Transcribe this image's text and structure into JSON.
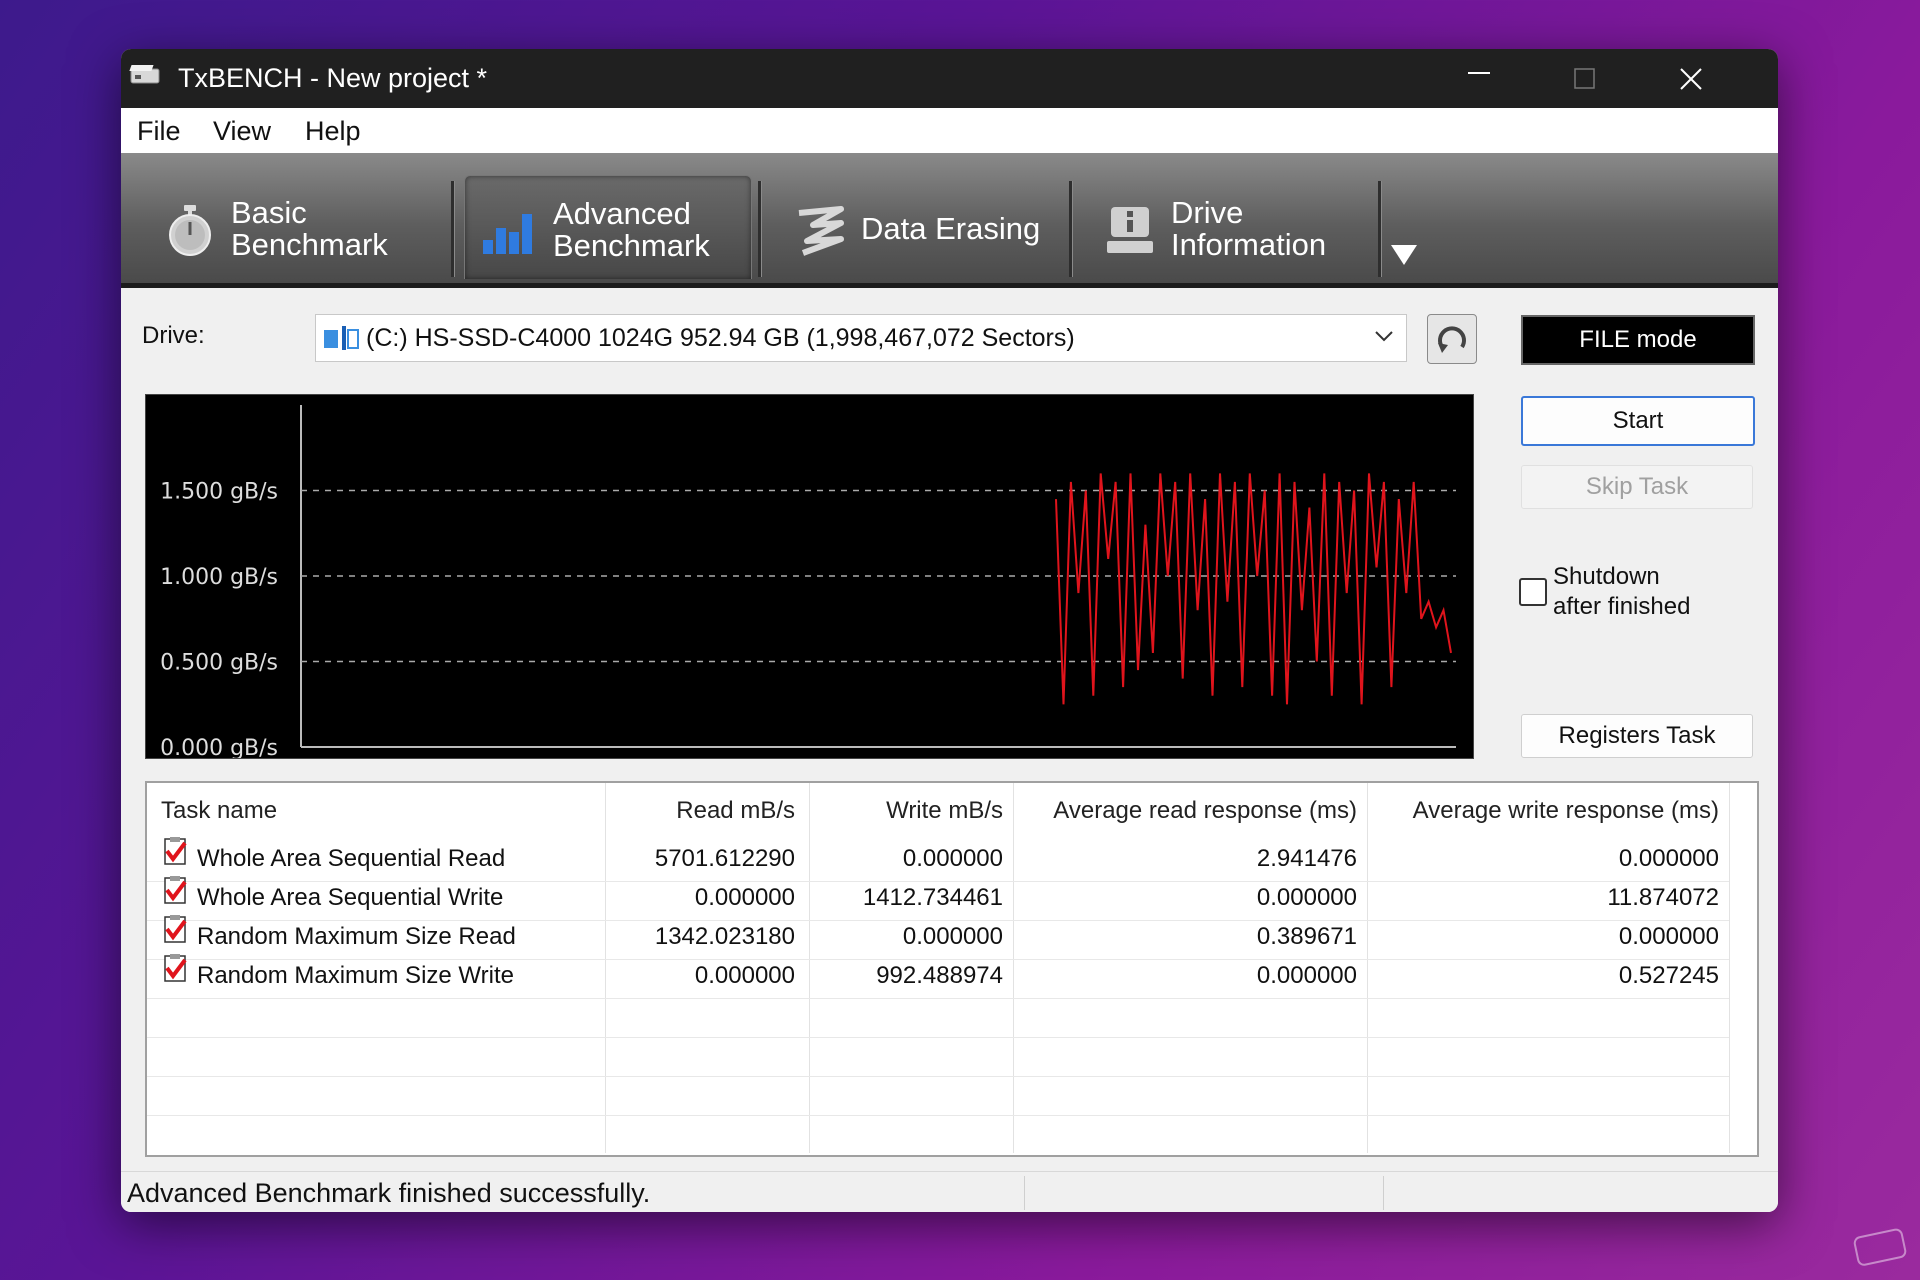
{
  "window": {
    "title": "TxBENCH - New project *"
  },
  "menu": [
    "File",
    "View",
    "Help"
  ],
  "tabs": [
    {
      "label": "Basic\nBenchmark",
      "icon": "stopwatch-icon",
      "active": false
    },
    {
      "label": "Advanced\nBenchmark",
      "icon": "bar-chart-icon",
      "active": true
    },
    {
      "label": "Data Erasing",
      "icon": "eraser-icon",
      "active": false
    },
    {
      "label": "Drive\nInformation",
      "icon": "drive-info-icon",
      "active": false
    }
  ],
  "drive": {
    "label": "Drive:",
    "selected": "(C:) HS-SSD-C4000 1024G  952.94 GB (1,998,467,072 Sectors)"
  },
  "buttons": {
    "file_mode": "FILE mode",
    "start": "Start",
    "skip_task": "Skip Task",
    "registers_task": "Registers Task"
  },
  "shutdown": {
    "label": "Shutdown\nafter finished",
    "checked": false
  },
  "chart_data": {
    "type": "line",
    "yticks": [
      "1.500 gB/s",
      "1.000 gB/s",
      "0.500 gB/s",
      "0.000 gB/s"
    ],
    "ylim": [
      0,
      2.0
    ],
    "grid": true,
    "series": [
      {
        "color": "#e0141c",
        "values": [
          1.45,
          0.25,
          1.55,
          0.9,
          1.5,
          0.3,
          1.6,
          1.1,
          1.55,
          0.35,
          1.6,
          0.45,
          1.3,
          0.55,
          1.6,
          1.0,
          1.55,
          0.4,
          1.6,
          0.8,
          1.45,
          0.3,
          1.6,
          0.85,
          1.55,
          0.35,
          1.6,
          1.0,
          1.5,
          0.3,
          1.6,
          0.25,
          1.55,
          0.8,
          1.4,
          0.5,
          1.6,
          0.3,
          1.55,
          0.9,
          1.5,
          0.25,
          1.6,
          1.05,
          1.55,
          0.35,
          1.45,
          0.9,
          1.55,
          0.75,
          0.85,
          0.7,
          0.8,
          0.55
        ]
      }
    ]
  },
  "table": {
    "headers": [
      "Task name",
      "Read mB/s",
      "Write mB/s",
      "Average read response (ms)",
      "Average write response (ms)"
    ],
    "rows": [
      [
        "Whole Area Sequential Read",
        "5701.612290",
        "0.000000",
        "2.941476",
        "0.000000"
      ],
      [
        "Whole Area Sequential Write",
        "0.000000",
        "1412.734461",
        "0.000000",
        "11.874072"
      ],
      [
        "Random Maximum Size Read",
        "1342.023180",
        "0.000000",
        "0.389671",
        "0.000000"
      ],
      [
        "Random Maximum Size Write",
        "0.000000",
        "992.488974",
        "0.000000",
        "0.527245"
      ]
    ]
  },
  "status": {
    "message": "Advanced Benchmark finished successfully."
  },
  "colors": {
    "accent": "#3a78d8",
    "chart_line": "#e0141c",
    "chart_bg": "#000000"
  }
}
